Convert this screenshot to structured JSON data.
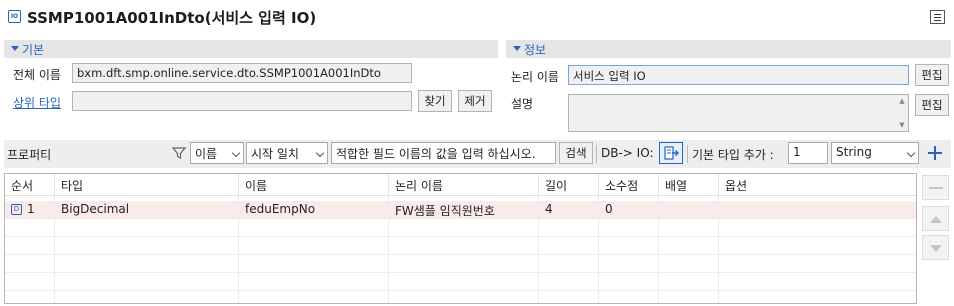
{
  "title": "SSMP1001A001InDto(서비스 입력 IO)",
  "title_icon_text": "IO",
  "basic": {
    "section_label": "기본",
    "full_name_label": "전체 이름",
    "full_name_value": "bxm.dft.smp.online.service.dto.SSMP1001A001InDto",
    "parent_type_label": "상위 타입",
    "parent_type_value": "",
    "find_button": "찾기",
    "remove_button": "제거"
  },
  "info": {
    "section_label": "정보",
    "logical_name_label": "논리 이름",
    "logical_name_value": "서비스 입력 IO",
    "edit_button": "편집",
    "description_label": "설명",
    "description_value": "",
    "edit_button_2": "편집"
  },
  "property_bar": {
    "label": "프로퍼티",
    "filter_field": "이름",
    "match_mode": "시작 일치",
    "search_placeholder": "적합한 필드 이름의 값을 입력 하십시오.",
    "search_button": "검색",
    "db_io_label": "DB-> IO:",
    "add_basic_type_label": "기본 타입 추가 :",
    "add_count": "1",
    "type_select": "String"
  },
  "table": {
    "columns": [
      "순서",
      "타입",
      "이름",
      "논리 이름",
      "길이",
      "소수점",
      "배열",
      "옵션"
    ],
    "rows": [
      {
        "order": "1",
        "type": "BigDecimal",
        "name": "feduEmpNo",
        "logical_name": "FW샘플 임직원번호",
        "length": "4",
        "decimal": "0",
        "array": "",
        "option": ""
      }
    ],
    "row_icon_text": "D"
  },
  "colors": {
    "accent": "#2a62c0",
    "section_bg": "#e5e5e5",
    "selected_row": "#fbeaea"
  }
}
